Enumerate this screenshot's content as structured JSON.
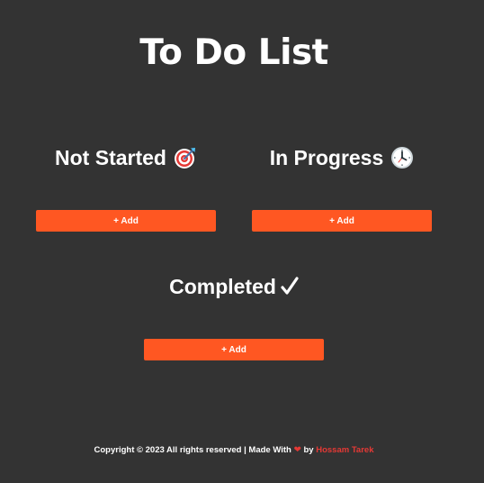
{
  "page": {
    "title": "To Do List"
  },
  "columns": [
    {
      "title": "Not Started",
      "icon": "dart-target-icon",
      "add_label": "+ Add"
    },
    {
      "title": "In Progress",
      "icon": "clock-icon",
      "add_label": "+ Add"
    },
    {
      "title": "Completed",
      "icon": "checkmark-icon",
      "add_label": "+ Add"
    }
  ],
  "footer": {
    "copyright": "Copyright © 2023 All rights reserved | Made With",
    "by": "by",
    "author": "Hossam Tarek"
  },
  "colors": {
    "background": "#333333",
    "accent": "#ff5722",
    "heart": "#e53935",
    "author_link": "#e53935",
    "text": "#ffffff"
  }
}
